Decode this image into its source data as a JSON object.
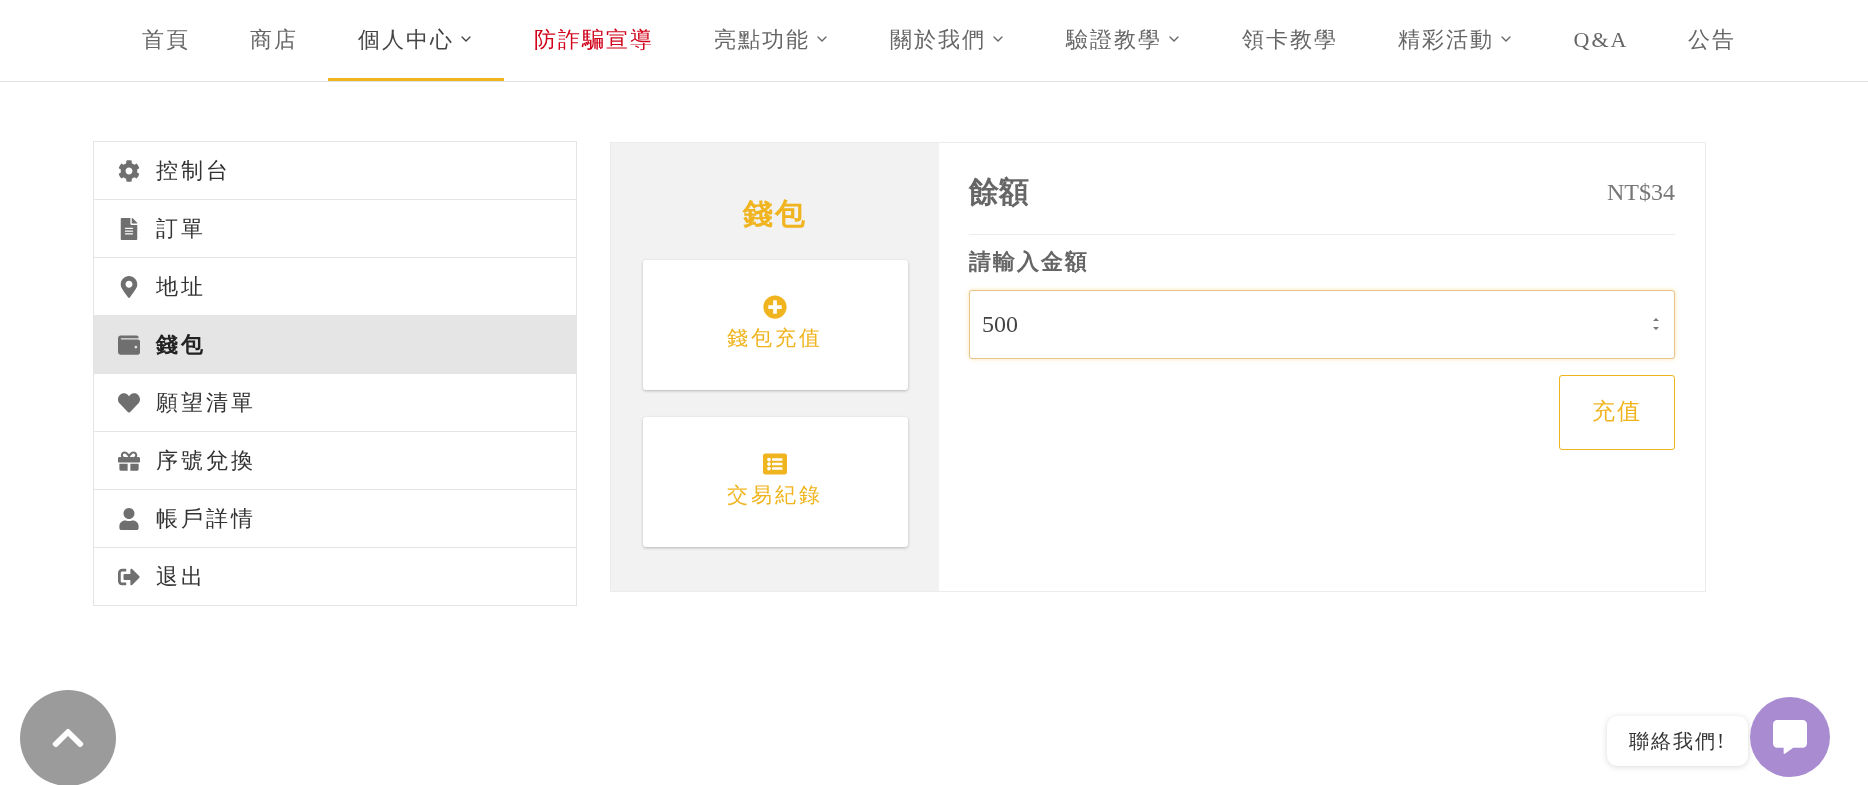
{
  "nav": [
    {
      "label": "首頁",
      "selected": false,
      "dropdown": false,
      "kind": "link"
    },
    {
      "label": "商店",
      "selected": false,
      "dropdown": false,
      "kind": "link"
    },
    {
      "label": "個人中心",
      "selected": true,
      "dropdown": true,
      "kind": "link"
    },
    {
      "label": "防詐騙宣導",
      "selected": false,
      "dropdown": false,
      "kind": "alert"
    },
    {
      "label": "亮點功能",
      "selected": false,
      "dropdown": true,
      "kind": "link"
    },
    {
      "label": "關於我們",
      "selected": false,
      "dropdown": true,
      "kind": "link"
    },
    {
      "label": "驗證教學",
      "selected": false,
      "dropdown": true,
      "kind": "link"
    },
    {
      "label": "領卡教學",
      "selected": false,
      "dropdown": false,
      "kind": "link"
    },
    {
      "label": "精彩活動",
      "selected": false,
      "dropdown": true,
      "kind": "link"
    },
    {
      "label": "Q&A",
      "selected": false,
      "dropdown": false,
      "kind": "link"
    },
    {
      "label": "公告",
      "selected": false,
      "dropdown": false,
      "kind": "link"
    }
  ],
  "sidebar": {
    "items": [
      {
        "label": "控制台",
        "selected": false
      },
      {
        "label": "訂單",
        "selected": false
      },
      {
        "label": "地址",
        "selected": false
      },
      {
        "label": "錢包",
        "selected": true
      },
      {
        "label": "願望清單",
        "selected": false
      },
      {
        "label": "序號兌換",
        "selected": false
      },
      {
        "label": "帳戶詳情",
        "selected": false
      },
      {
        "label": "退出",
        "selected": false
      }
    ]
  },
  "wallet": {
    "title": "錢包",
    "actions": [
      {
        "label": "錢包充值"
      },
      {
        "label": "交易紀錄"
      }
    ]
  },
  "balance": {
    "title": "餘額",
    "amount": "NT$34",
    "field_label": "請輸入金額",
    "value": "500",
    "button": "充值"
  },
  "chat": {
    "label": "聯絡我們!"
  }
}
